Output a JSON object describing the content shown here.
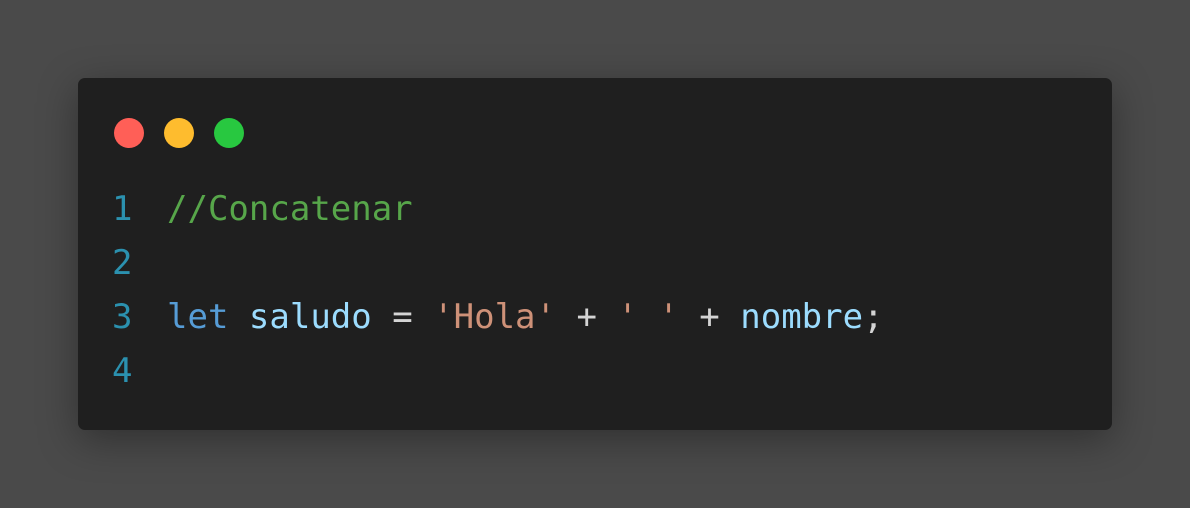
{
  "window": {
    "dots": [
      {
        "name": "close",
        "color": "#ff5f57"
      },
      {
        "name": "minimize",
        "color": "#febc2e"
      },
      {
        "name": "maximize",
        "color": "#28c840"
      }
    ]
  },
  "code": {
    "lines": [
      {
        "number": "1",
        "tokens": [
          {
            "text": "//Concatenar",
            "type": "comment"
          }
        ]
      },
      {
        "number": "2",
        "tokens": []
      },
      {
        "number": "3",
        "tokens": [
          {
            "text": "let",
            "type": "keyword"
          },
          {
            "text": " ",
            "type": "op"
          },
          {
            "text": "saludo",
            "type": "var"
          },
          {
            "text": " = ",
            "type": "op"
          },
          {
            "text": "'Hola'",
            "type": "string"
          },
          {
            "text": " + ",
            "type": "op"
          },
          {
            "text": "' '",
            "type": "string"
          },
          {
            "text": " + ",
            "type": "op"
          },
          {
            "text": "nombre",
            "type": "var"
          },
          {
            "text": ";",
            "type": "op"
          }
        ]
      },
      {
        "number": "4",
        "tokens": []
      }
    ],
    "colors": {
      "line_number": "#2b91af",
      "comment": "#57a64a",
      "keyword": "#569cd6",
      "variable": "#9cdcfe",
      "string": "#ce9178",
      "operator": "#d4d4d4"
    }
  }
}
